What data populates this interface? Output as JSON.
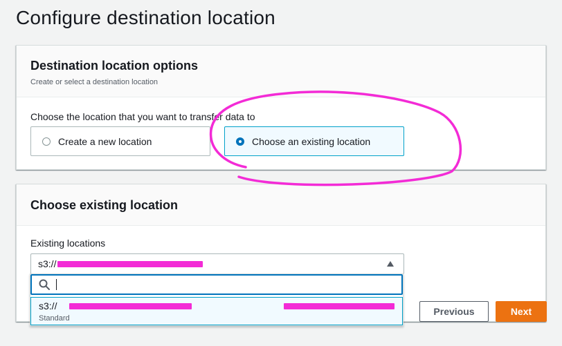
{
  "page": {
    "title": "Configure destination location"
  },
  "destination_options": {
    "title": "Destination location options",
    "description": "Create or select a destination location",
    "field_label": "Choose the location that you want to transfer data to",
    "options": [
      {
        "label": "Create a new location",
        "selected": false
      },
      {
        "label": "Choose an existing location",
        "selected": true
      }
    ]
  },
  "existing_location": {
    "title": "Choose existing location",
    "field_label": "Existing locations",
    "selected_value_prefix": "s3://",
    "search": {
      "value": ""
    },
    "option": {
      "value_prefix": "s3://",
      "sublabel": "Standard"
    }
  },
  "buttons": {
    "previous": "Previous",
    "next": "Next"
  },
  "colors": {
    "accent_blue": "#0073bb",
    "primary_orange": "#ec7211",
    "annotation_magenta": "#f32bd6",
    "selected_bg": "#f1faff"
  }
}
